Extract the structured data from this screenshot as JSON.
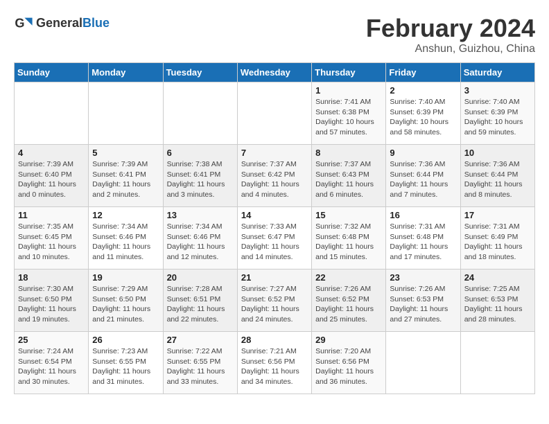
{
  "header": {
    "logo_general": "General",
    "logo_blue": "Blue",
    "month": "February 2024",
    "location": "Anshun, Guizhou, China"
  },
  "weekdays": [
    "Sunday",
    "Monday",
    "Tuesday",
    "Wednesday",
    "Thursday",
    "Friday",
    "Saturday"
  ],
  "weeks": [
    [
      {
        "day": "",
        "info": ""
      },
      {
        "day": "",
        "info": ""
      },
      {
        "day": "",
        "info": ""
      },
      {
        "day": "",
        "info": ""
      },
      {
        "day": "1",
        "info": "Sunrise: 7:41 AM\nSunset: 6:38 PM\nDaylight: 10 hours\nand 57 minutes."
      },
      {
        "day": "2",
        "info": "Sunrise: 7:40 AM\nSunset: 6:39 PM\nDaylight: 10 hours\nand 58 minutes."
      },
      {
        "day": "3",
        "info": "Sunrise: 7:40 AM\nSunset: 6:39 PM\nDaylight: 10 hours\nand 59 minutes."
      }
    ],
    [
      {
        "day": "4",
        "info": "Sunrise: 7:39 AM\nSunset: 6:40 PM\nDaylight: 11 hours\nand 0 minutes."
      },
      {
        "day": "5",
        "info": "Sunrise: 7:39 AM\nSunset: 6:41 PM\nDaylight: 11 hours\nand 2 minutes."
      },
      {
        "day": "6",
        "info": "Sunrise: 7:38 AM\nSunset: 6:41 PM\nDaylight: 11 hours\nand 3 minutes."
      },
      {
        "day": "7",
        "info": "Sunrise: 7:37 AM\nSunset: 6:42 PM\nDaylight: 11 hours\nand 4 minutes."
      },
      {
        "day": "8",
        "info": "Sunrise: 7:37 AM\nSunset: 6:43 PM\nDaylight: 11 hours\nand 6 minutes."
      },
      {
        "day": "9",
        "info": "Sunrise: 7:36 AM\nSunset: 6:44 PM\nDaylight: 11 hours\nand 7 minutes."
      },
      {
        "day": "10",
        "info": "Sunrise: 7:36 AM\nSunset: 6:44 PM\nDaylight: 11 hours\nand 8 minutes."
      }
    ],
    [
      {
        "day": "11",
        "info": "Sunrise: 7:35 AM\nSunset: 6:45 PM\nDaylight: 11 hours\nand 10 minutes."
      },
      {
        "day": "12",
        "info": "Sunrise: 7:34 AM\nSunset: 6:46 PM\nDaylight: 11 hours\nand 11 minutes."
      },
      {
        "day": "13",
        "info": "Sunrise: 7:34 AM\nSunset: 6:46 PM\nDaylight: 11 hours\nand 12 minutes."
      },
      {
        "day": "14",
        "info": "Sunrise: 7:33 AM\nSunset: 6:47 PM\nDaylight: 11 hours\nand 14 minutes."
      },
      {
        "day": "15",
        "info": "Sunrise: 7:32 AM\nSunset: 6:48 PM\nDaylight: 11 hours\nand 15 minutes."
      },
      {
        "day": "16",
        "info": "Sunrise: 7:31 AM\nSunset: 6:48 PM\nDaylight: 11 hours\nand 17 minutes."
      },
      {
        "day": "17",
        "info": "Sunrise: 7:31 AM\nSunset: 6:49 PM\nDaylight: 11 hours\nand 18 minutes."
      }
    ],
    [
      {
        "day": "18",
        "info": "Sunrise: 7:30 AM\nSunset: 6:50 PM\nDaylight: 11 hours\nand 19 minutes."
      },
      {
        "day": "19",
        "info": "Sunrise: 7:29 AM\nSunset: 6:50 PM\nDaylight: 11 hours\nand 21 minutes."
      },
      {
        "day": "20",
        "info": "Sunrise: 7:28 AM\nSunset: 6:51 PM\nDaylight: 11 hours\nand 22 minutes."
      },
      {
        "day": "21",
        "info": "Sunrise: 7:27 AM\nSunset: 6:52 PM\nDaylight: 11 hours\nand 24 minutes."
      },
      {
        "day": "22",
        "info": "Sunrise: 7:26 AM\nSunset: 6:52 PM\nDaylight: 11 hours\nand 25 minutes."
      },
      {
        "day": "23",
        "info": "Sunrise: 7:26 AM\nSunset: 6:53 PM\nDaylight: 11 hours\nand 27 minutes."
      },
      {
        "day": "24",
        "info": "Sunrise: 7:25 AM\nSunset: 6:53 PM\nDaylight: 11 hours\nand 28 minutes."
      }
    ],
    [
      {
        "day": "25",
        "info": "Sunrise: 7:24 AM\nSunset: 6:54 PM\nDaylight: 11 hours\nand 30 minutes."
      },
      {
        "day": "26",
        "info": "Sunrise: 7:23 AM\nSunset: 6:55 PM\nDaylight: 11 hours\nand 31 minutes."
      },
      {
        "day": "27",
        "info": "Sunrise: 7:22 AM\nSunset: 6:55 PM\nDaylight: 11 hours\nand 33 minutes."
      },
      {
        "day": "28",
        "info": "Sunrise: 7:21 AM\nSunset: 6:56 PM\nDaylight: 11 hours\nand 34 minutes."
      },
      {
        "day": "29",
        "info": "Sunrise: 7:20 AM\nSunset: 6:56 PM\nDaylight: 11 hours\nand 36 minutes."
      },
      {
        "day": "",
        "info": ""
      },
      {
        "day": "",
        "info": ""
      }
    ]
  ]
}
